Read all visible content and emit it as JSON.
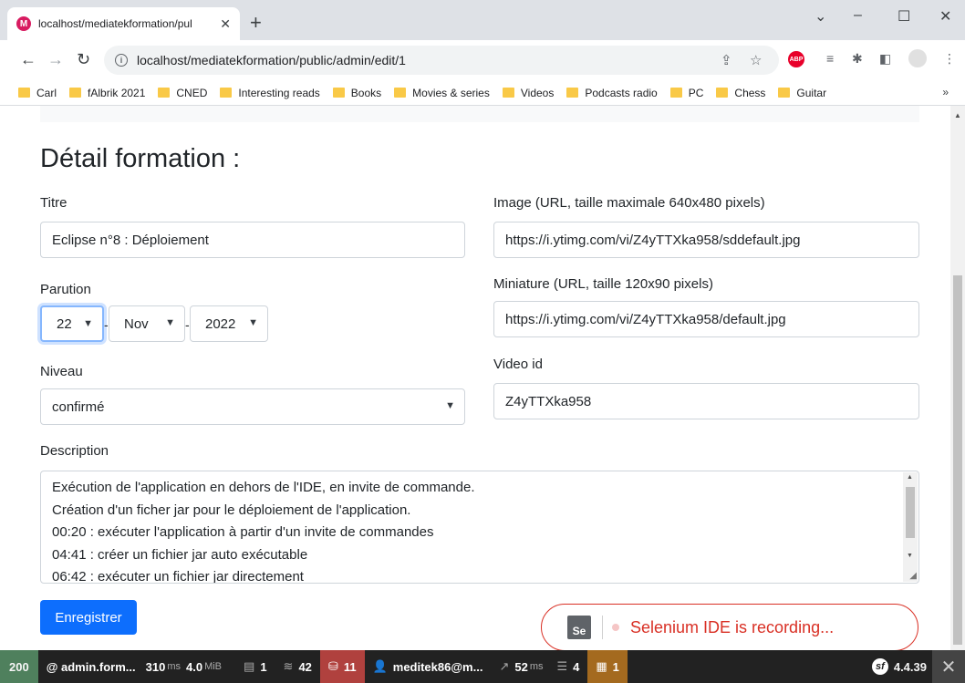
{
  "browser": {
    "tab_title": "localhost/mediatekformation/pul",
    "url": "localhost/mediatekformation/public/admin/edit/1",
    "abp_label": "ABP",
    "bookmarks": [
      "Carl",
      "fAlbrik 2021",
      "CNED",
      "Interesting reads",
      "Books",
      "Movies & series",
      "Videos",
      "Podcasts radio",
      "PC",
      "Chess",
      "Guitar"
    ]
  },
  "page": {
    "title": "Détail formation :",
    "titre_label": "Titre",
    "titre_value": "Eclipse n°8 : Déploiement",
    "parution_label": "Parution",
    "parution_day": "22",
    "parution_month": "Nov",
    "parution_year": "2022",
    "niveau_label": "Niveau",
    "niveau_value": "confirmé",
    "image_label": "Image (URL, taille maximale 640x480 pixels)",
    "image_value": "https://i.ytimg.com/vi/Z4yTTXka958/sddefault.jpg",
    "miniature_label": "Miniature (URL, taille 120x90 pixels)",
    "miniature_value": "https://i.ytimg.com/vi/Z4yTTXka958/default.jpg",
    "video_label": "Video id",
    "video_value": "Z4yTTXka958",
    "description_label": "Description",
    "description_lines": [
      "Exécution de l'application en dehors de l'IDE, en invite de commande.",
      "Création d'un ficher jar pour le déploiement de l'application.",
      "00:20 : exécuter l'application à partir d'un invite de commandes",
      "04:41 : créer un fichier jar auto exécutable",
      "06:42 : exécuter un fichier jar directement"
    ],
    "save_label": "Enregistrer"
  },
  "selenium": {
    "logo": "Se",
    "text": "Selenium IDE is recording..."
  },
  "debug_toolbar": {
    "status": "200",
    "route": "@ admin.form...",
    "time_value": "310",
    "time_unit": "ms",
    "memory_value": "4.0",
    "memory_unit": "MiB",
    "forms_count": "1",
    "twig_count": "42",
    "db_count": "11",
    "user": "meditek86@m...",
    "perf_value": "52",
    "perf_unit": "ms",
    "cache_count": "4",
    "deprecations_count": "1",
    "version": "4.4.39"
  }
}
